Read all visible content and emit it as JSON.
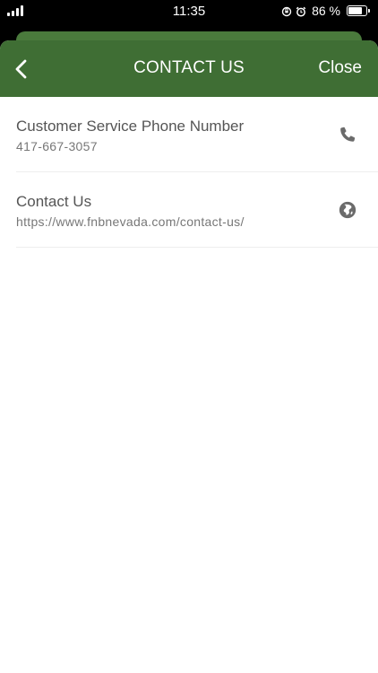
{
  "status_bar": {
    "time": "11:35",
    "battery_text": "86 %",
    "battery_level_percent": 86,
    "signal_bars": 4
  },
  "header": {
    "title": "CONTACT US",
    "close_label": "Close",
    "back_icon": "chevron-left-icon",
    "background_color": "#3f6e34"
  },
  "contacts": [
    {
      "label": "Customer Service Phone Number",
      "value": "417-667-3057",
      "icon": "phone-icon"
    },
    {
      "label": "Contact Us",
      "value": "https://www.fnbnevada.com/contact-us/",
      "icon": "globe-icon"
    }
  ]
}
